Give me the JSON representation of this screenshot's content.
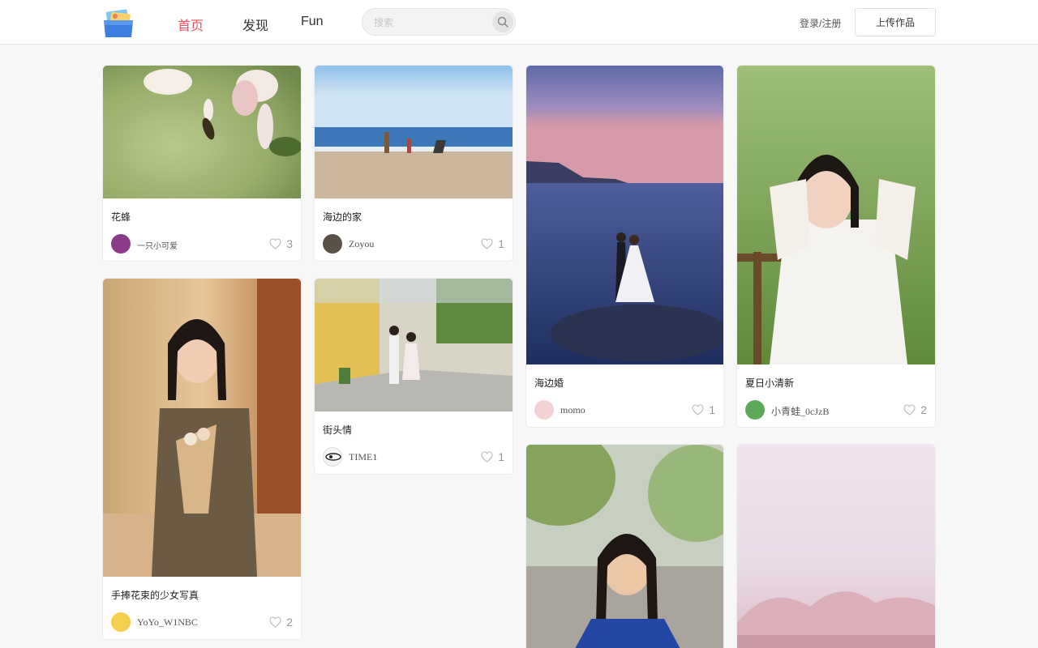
{
  "header": {
    "nav": [
      {
        "label": "首页",
        "active": true
      },
      {
        "label": "发现",
        "active": false
      },
      {
        "label": "Fun",
        "active": false
      }
    ],
    "search": {
      "placeholder": "搜索"
    },
    "login_label": "登录/注册",
    "upload_label": "上传作品"
  },
  "colors": {
    "accent": "#e8505b"
  },
  "cards": [
    {
      "title": "花蜂",
      "author": "一只小可爱",
      "likes": "3"
    },
    {
      "title": "海边的家",
      "author": "Zoyou",
      "likes": "1"
    },
    {
      "title": "海边婚",
      "author": "momo",
      "likes": "1"
    },
    {
      "title": "夏日小清新",
      "author": "小青蛙_0cJzB",
      "likes": "2"
    },
    {
      "title": "手捧花束的少女写真",
      "author": "YoYo_W1NBC",
      "likes": "2"
    },
    {
      "title": "街头情",
      "author": "TIME1",
      "likes": "1"
    },
    {
      "title": "",
      "author": "",
      "likes": ""
    },
    {
      "title": "",
      "author": "",
      "likes": ""
    }
  ]
}
